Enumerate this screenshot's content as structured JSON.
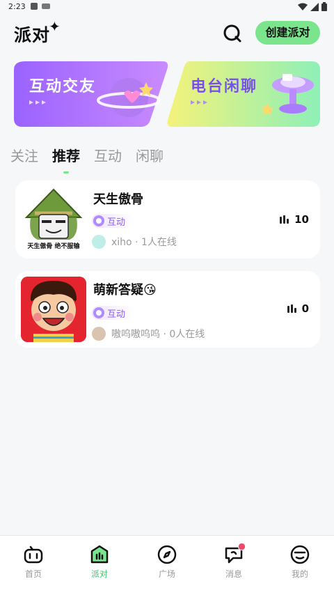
{
  "status_bar": {
    "time": "2:23"
  },
  "header": {
    "logo": "派对",
    "logo_spark": "✦",
    "create_button": "创建派对",
    "search_icon": "search-icon"
  },
  "banners": [
    {
      "title": "互动交友",
      "colors": [
        "#9a63ff",
        "#c98bff"
      ]
    },
    {
      "title": "电台闲聊",
      "colors": [
        "#f4f27a",
        "#8ef0b8"
      ]
    }
  ],
  "tabs": [
    {
      "label": "关注",
      "active": false
    },
    {
      "label": "推荐",
      "active": true
    },
    {
      "label": "互动",
      "active": false
    },
    {
      "label": "闲聊",
      "active": false
    }
  ],
  "rooms": [
    {
      "title": "天生傲骨",
      "tag": "互动",
      "host": "xiho · 1人在线",
      "count": "10",
      "cover_caption": "天生傲骨 绝不服输"
    },
    {
      "title": "萌新答疑😘",
      "tag": "互动",
      "host": "嗷呜嗷呜呜 · 0人在线",
      "count": "0"
    }
  ],
  "bottom_nav": [
    {
      "label": "首页",
      "icon": "game-controller-icon",
      "active": false
    },
    {
      "label": "派对",
      "icon": "party-icon",
      "active": true
    },
    {
      "label": "广场",
      "icon": "compass-icon",
      "active": false
    },
    {
      "label": "消息",
      "icon": "message-icon",
      "active": false,
      "badge": true
    },
    {
      "label": "我的",
      "icon": "profile-icon",
      "active": false
    }
  ],
  "colors": {
    "accent": "#7ae58c",
    "active_nav": "#3cc46a",
    "tag_text": "#8a5cf5",
    "badge": "#f0486a"
  }
}
